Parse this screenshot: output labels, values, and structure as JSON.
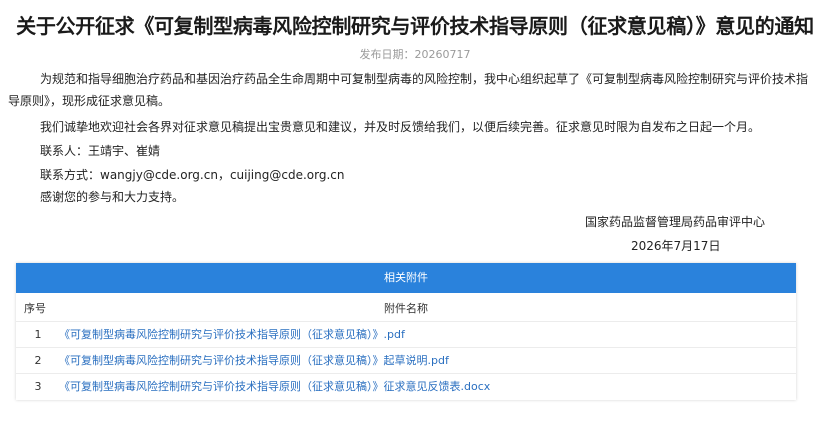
{
  "notice": {
    "title": "关于公开征求《可复制型病毒风险控制研究与评价技术指导原则（征求意见稿）》意见的通知",
    "publish_label": "发布日期：",
    "publish_date": "20260717",
    "paragraph1_line1": "为规范和指导细胞治疗药品和基因治疗药品全生命周期中可复制型病毒的风险控制，我中心组织起草了《可复制型病毒风险控制研究与评价技术指",
    "paragraph1_line2": "导原则》，现形成征求意见稿。",
    "paragraph2": "我们诚挚地欢迎社会各界对征求意见稿提出宝贵意见和建议，并及时反馈给我们，以便后续完善。征求意见时限为自发布之日起一个月。",
    "contact_person": "联系人：王靖宇、崔婧",
    "contact_info": "联系方式：wangjy@cde.org.cn，cuijing@cde.org.cn",
    "thanks": "感谢您的参与和大力支持。",
    "signature_org": "国家药品监督管理局药品审评中心",
    "signature_date": "2026年7月17日"
  },
  "attachments": {
    "header": "相关附件",
    "col_index": "序号",
    "col_name": "附件名称",
    "items": [
      {
        "index": "1",
        "name": "《可复制型病毒风险控制研究与评价技术指导原则（征求意见稿）》.pdf"
      },
      {
        "index": "2",
        "name": "《可复制型病毒风险控制研究与评价技术指导原则（征求意见稿）》起草说明.pdf"
      },
      {
        "index": "3",
        "name": "《可复制型病毒风险控制研究与评价技术指导原则（征求意见稿）》征求意见反馈表.docx"
      }
    ]
  }
}
